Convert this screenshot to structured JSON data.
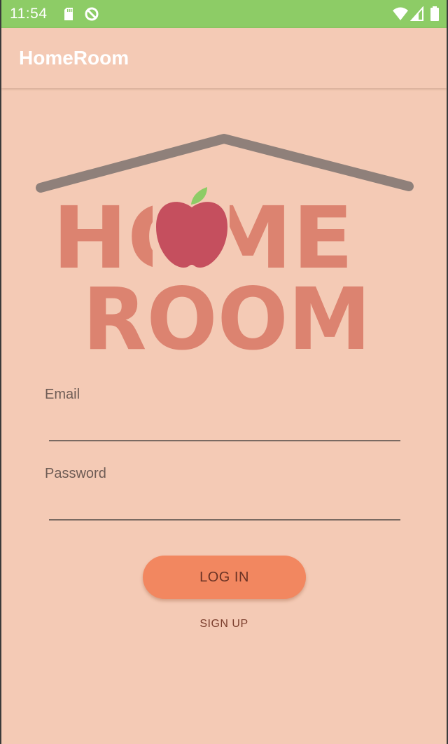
{
  "status_bar": {
    "time": "11:54",
    "icons": [
      "sd-card-icon",
      "data-saver-icon",
      "wifi-icon",
      "signal-icon",
      "battery-icon"
    ],
    "color": "#8dcc66"
  },
  "app_bar": {
    "title": "HomeRoom"
  },
  "logo": {
    "line1": "HOME",
    "line2": "ROOM",
    "icon": "apple-icon"
  },
  "form": {
    "email": {
      "label": "Email",
      "value": ""
    },
    "password": {
      "label": "Password",
      "value": ""
    }
  },
  "buttons": {
    "login_label": "LOG IN",
    "signup_label": "SIGN UP"
  },
  "colors": {
    "background": "#f4cab5",
    "accent": "#f28760",
    "logo_text": "#dc8370",
    "apple": "#c54f5e",
    "leaf": "#8dcc66",
    "roof": "#8f807a"
  }
}
